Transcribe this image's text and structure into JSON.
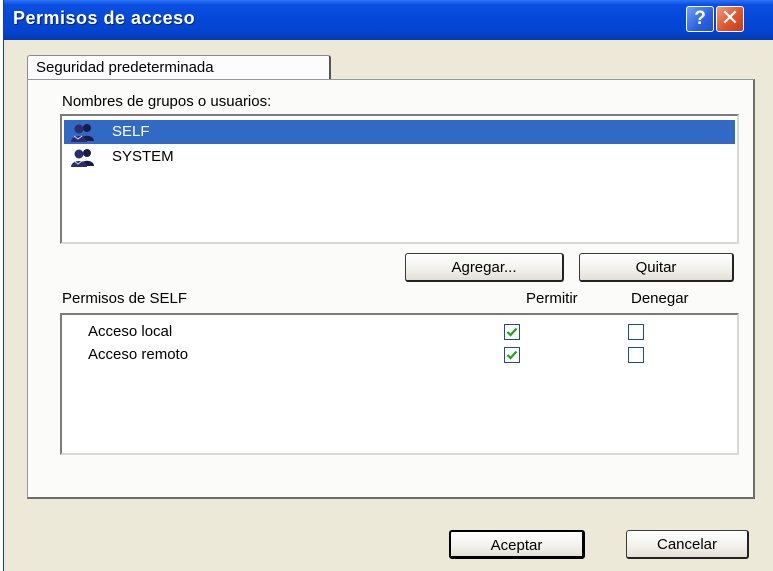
{
  "window": {
    "title": "Permisos de acceso",
    "help_glyph": "?",
    "close_glyph": "✕"
  },
  "tab": {
    "label": "Seguridad predeterminada"
  },
  "users": {
    "label": "Nombres de grupos o usuarios:",
    "items": [
      {
        "name": "SELF",
        "icon": "users-group-icon",
        "selected": true
      },
      {
        "name": "SYSTEM",
        "icon": "users-group-icon",
        "selected": false
      }
    ],
    "add_label": "Agregar...",
    "remove_label": "Quitar"
  },
  "permissions": {
    "label": "Permisos de SELF",
    "allow_header": "Permitir",
    "deny_header": "Denegar",
    "rows": [
      {
        "label": "Acceso local",
        "allow": true,
        "deny": false
      },
      {
        "label": "Acceso remoto",
        "allow": true,
        "deny": false
      }
    ]
  },
  "footer": {
    "ok_label": "Aceptar",
    "cancel_label": "Cancelar"
  },
  "colors": {
    "titlebar": "#0447d6",
    "selection": "#316ac5",
    "checkmark": "#21a121",
    "face": "#ece9d8"
  }
}
